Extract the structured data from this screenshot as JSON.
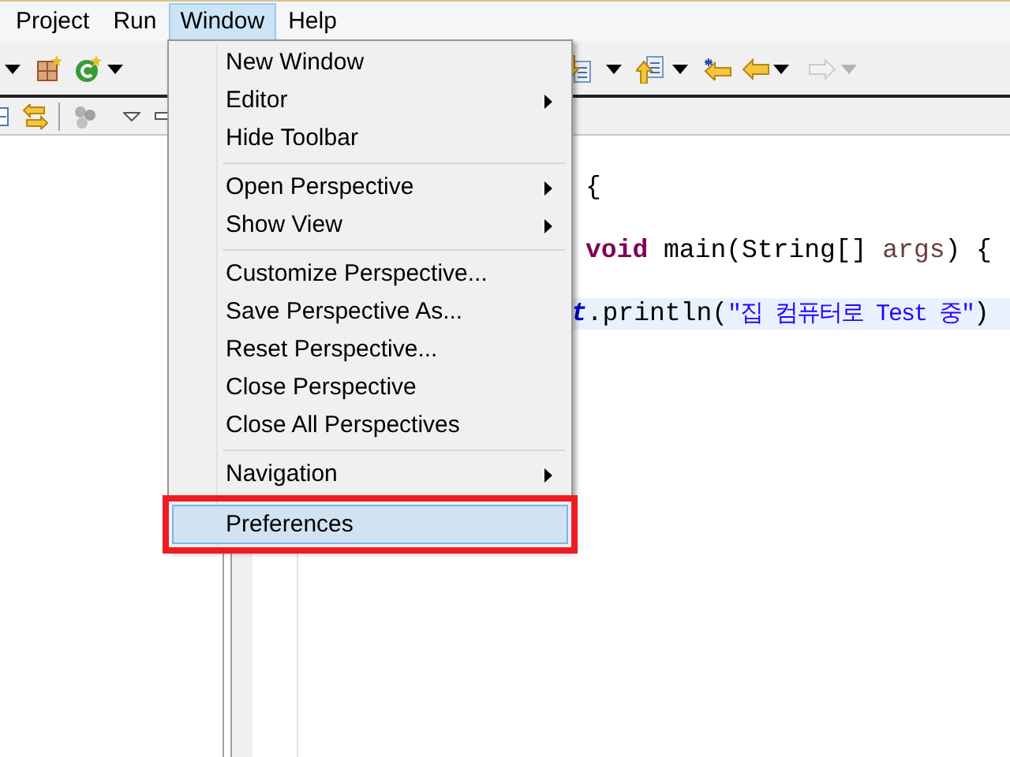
{
  "menubar": [
    {
      "label": "Project",
      "selected": false
    },
    {
      "label": "Run",
      "selected": false
    },
    {
      "label": "Window",
      "selected": true
    },
    {
      "label": "Help",
      "selected": false
    }
  ],
  "toolbar_buttons": [
    {
      "kind": "dropdown",
      "disabled": false
    },
    {
      "kind": "new-package",
      "disabled": false
    },
    {
      "kind": "new-class",
      "disabled": false
    },
    {
      "kind": "dropdown",
      "disabled": false
    },
    {
      "kind": "next-annotation",
      "disabled": false
    },
    {
      "kind": "dropdown",
      "disabled": false
    },
    {
      "kind": "previous-annotation",
      "disabled": false
    },
    {
      "kind": "dropdown",
      "disabled": false
    },
    {
      "kind": "last-edit",
      "disabled": false
    },
    {
      "kind": "back",
      "disabled": false
    },
    {
      "kind": "dropdown",
      "disabled": false
    },
    {
      "kind": "forward",
      "disabled": true
    },
    {
      "kind": "dropdown",
      "disabled": true
    }
  ],
  "code_lines": [
    {
      "highlighted": false,
      "tokens": [
        {
          "kind": "plain",
          "text": "{"
        }
      ]
    },
    {
      "highlighted": false,
      "tokens": [
        {
          "kind": "keyword",
          "text": "void"
        },
        {
          "kind": "plain",
          "text": " main(String[] "
        },
        {
          "kind": "param",
          "text": "args"
        },
        {
          "kind": "plain",
          "text": ") {"
        }
      ]
    },
    {
      "highlighted": true,
      "tokens": [
        {
          "kind": "field",
          "text": "t"
        },
        {
          "kind": "plain",
          "text": ".println("
        },
        {
          "kind": "string",
          "text": "\"집 컴퓨터로 Test 중\""
        },
        {
          "kind": "plain",
          "text": ")"
        }
      ]
    }
  ],
  "window_menu": {
    "groups": [
      [
        {
          "label": "New Window",
          "submenu": false,
          "selected": false,
          "annotated": false
        },
        {
          "label": "Editor",
          "submenu": true,
          "selected": false,
          "annotated": false
        },
        {
          "label": "Hide Toolbar",
          "submenu": false,
          "selected": false,
          "annotated": false
        }
      ],
      [
        {
          "label": "Open Perspective",
          "submenu": true,
          "selected": false,
          "annotated": false
        },
        {
          "label": "Show View",
          "submenu": true,
          "selected": false,
          "annotated": false
        }
      ],
      [
        {
          "label": "Customize Perspective...",
          "submenu": false,
          "selected": false,
          "annotated": false
        },
        {
          "label": "Save Perspective As...",
          "submenu": false,
          "selected": false,
          "annotated": false
        },
        {
          "label": "Reset Perspective...",
          "submenu": false,
          "selected": false,
          "annotated": false
        },
        {
          "label": "Close Perspective",
          "submenu": false,
          "selected": false,
          "annotated": false
        },
        {
          "label": "Close All Perspectives",
          "submenu": false,
          "selected": false,
          "annotated": false
        }
      ],
      [
        {
          "label": "Navigation",
          "submenu": true,
          "selected": false,
          "annotated": false
        }
      ],
      [
        {
          "label": "Preferences",
          "submenu": false,
          "selected": true,
          "annotated": true
        }
      ]
    ]
  }
}
